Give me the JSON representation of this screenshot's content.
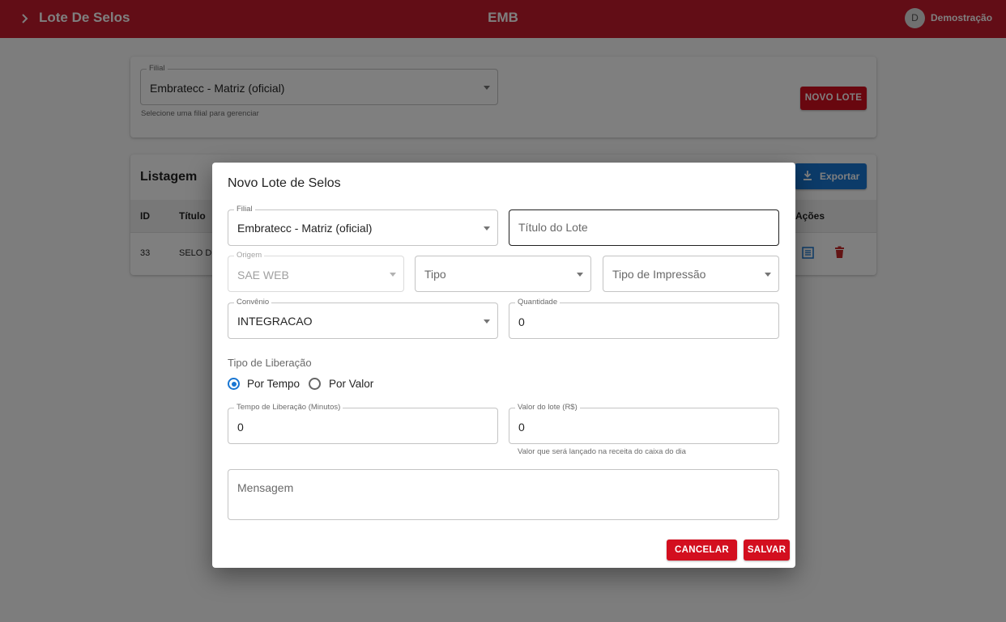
{
  "appbar": {
    "menu_icon": "chevron-right-icon",
    "title": "Lote De Selos",
    "brand": "EMB",
    "avatar_initial": "D",
    "user_name": "Demostração",
    "color": "#c41a2c"
  },
  "filter_card": {
    "filial_label": "Filial",
    "filial_value": "Embratecc - Matriz (oficial)",
    "filial_helper": "Selecione uma filial para gerenciar",
    "new_button_label": "NOVO LOTE"
  },
  "listing": {
    "title": "Listagem",
    "export_label": "Exportar",
    "export_icon": "download-icon",
    "columns": [
      "ID",
      "Título",
      "Ações"
    ],
    "rows": [
      {
        "id": "33",
        "titulo": "SELO D"
      }
    ],
    "row_actions": [
      "list-icon",
      "trash-icon"
    ]
  },
  "dialog": {
    "title": "Novo Lote de Selos",
    "fields": {
      "filial": {
        "label": "Filial",
        "value": "Embratecc - Matriz (oficial)"
      },
      "titulo": {
        "placeholder": "Título do Lote"
      },
      "origem": {
        "label": "Origem",
        "value": "SAE WEB"
      },
      "tipo": {
        "placeholder": "Tipo"
      },
      "tipo_impressao": {
        "placeholder": "Tipo de Impressão"
      },
      "convenio": {
        "label": "Convênio",
        "value": "INTEGRACAO"
      },
      "quantidade": {
        "label": "Quantidade",
        "value": "0"
      },
      "tempo_liberacao": {
        "label": "Tempo de Liberação (Minutos)",
        "value": "0"
      },
      "valor_lote": {
        "label": "Valor do lote (R$)",
        "value": "0",
        "helper": "Valor que será lançado na receita do caixa do dia"
      },
      "mensagem": {
        "placeholder": "Mensagem"
      }
    },
    "liberacao": {
      "label": "Tipo de Liberação",
      "options": [
        "Por Tempo",
        "Por Valor"
      ],
      "selected": "Por Tempo"
    },
    "cancel_label": "CANCELAR",
    "save_label": "SALVAR"
  },
  "colors": {
    "primary_red": "#d30f1f",
    "accent_blue": "#1976d2",
    "backdrop": "rgba(0,0,0,0.5)"
  }
}
